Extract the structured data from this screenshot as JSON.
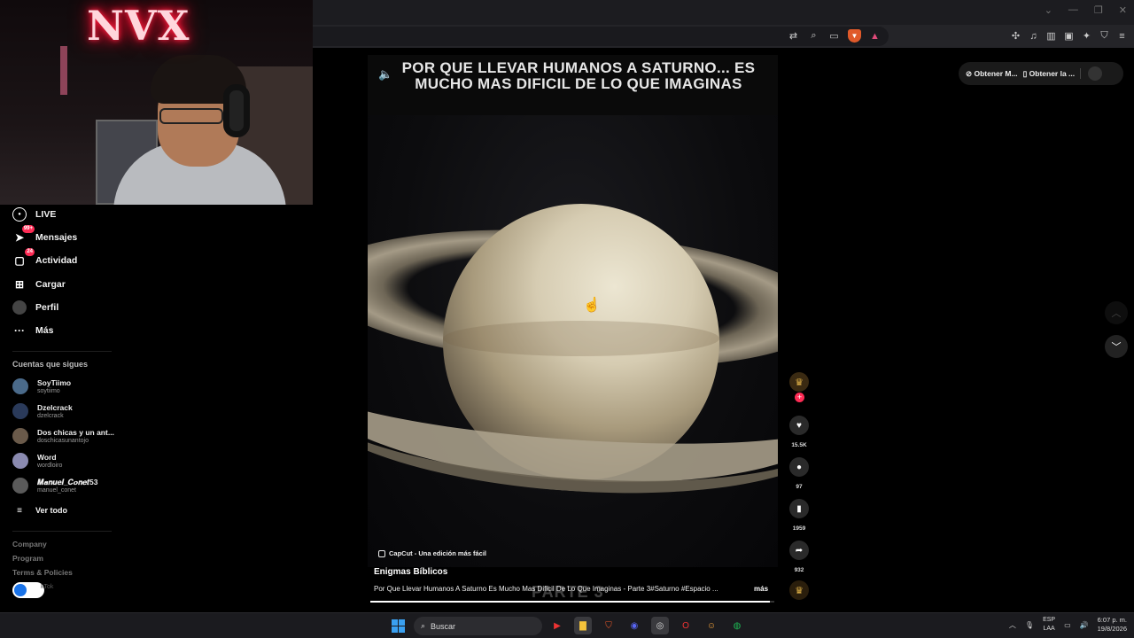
{
  "browser": {
    "window_controls": [
      "⌄",
      "—",
      "❐",
      "✕"
    ],
    "url_icons": [
      "translate-icon",
      "zoom-icon",
      "cast-icon"
    ],
    "extension_icons": [
      "extensions-icon",
      "music-icon",
      "sidebar-icon",
      "wallet-icon",
      "leo-icon",
      "vpn-icon",
      "menu-icon"
    ]
  },
  "webcam": {
    "neon_sign": "NVX"
  },
  "sidebar": {
    "nav": [
      {
        "label": "LIVE",
        "icon": "live-icon",
        "badge": ""
      },
      {
        "label": "Mensajes",
        "icon": "messages-icon",
        "badge": "99+"
      },
      {
        "label": "Actividad",
        "icon": "activity-icon",
        "badge": "24"
      },
      {
        "label": "Cargar",
        "icon": "upload-icon",
        "badge": ""
      },
      {
        "label": "Perfil",
        "icon": "profile-icon",
        "badge": ""
      },
      {
        "label": "Más",
        "icon": "more-icon",
        "badge": ""
      }
    ],
    "following_title": "Cuentas que sigues",
    "following": [
      {
        "name": "SoyTiimo",
        "user": "soytiimo"
      },
      {
        "name": "Dzelcrack",
        "user": "dzelcrack"
      },
      {
        "name": "Dos chicas y un ant...",
        "user": "doschicasunantojo"
      },
      {
        "name": "Word",
        "user": "wordloiro"
      },
      {
        "name": "𝑴𝒂𝒏𝒖𝒆𝒍_𝑪𝒐𝒏𝒆𝒕53",
        "user": "manuel_conet"
      }
    ],
    "see_all": "Ver todo",
    "footer": [
      "Company",
      "Program",
      "Terms & Policies"
    ],
    "footer_copyright": "kTok"
  },
  "video": {
    "caption": "POR QUE LLEVAR HUMANOS A SATURNO... ES MUCHO MAS DIFICIL DE LO QUE IMAGINAS",
    "watermark": "CapCut - Una edición más fácil",
    "author": "Enigmas Bíblicos",
    "description": "Por Que Llevar Humanos A Saturno Es Mucho Mas Dificil De Lo Que Imaginas - Parte 3#Saturno #Espacio ...",
    "more": "más",
    "overlay_text": "PARTE 3",
    "progress": 0.99
  },
  "actions": {
    "likes": "15.5K",
    "comments": "97",
    "saves": "1959",
    "shares": "932"
  },
  "get_app": {
    "pc_label": "Obtener M...",
    "mobile_label": "Obtener la ..."
  },
  "taskbar": {
    "search_placeholder": "Buscar",
    "lang_top": "ESP",
    "lang_bottom": "LAA",
    "time": "6:07 p. m.",
    "date": "19/8/2026"
  }
}
